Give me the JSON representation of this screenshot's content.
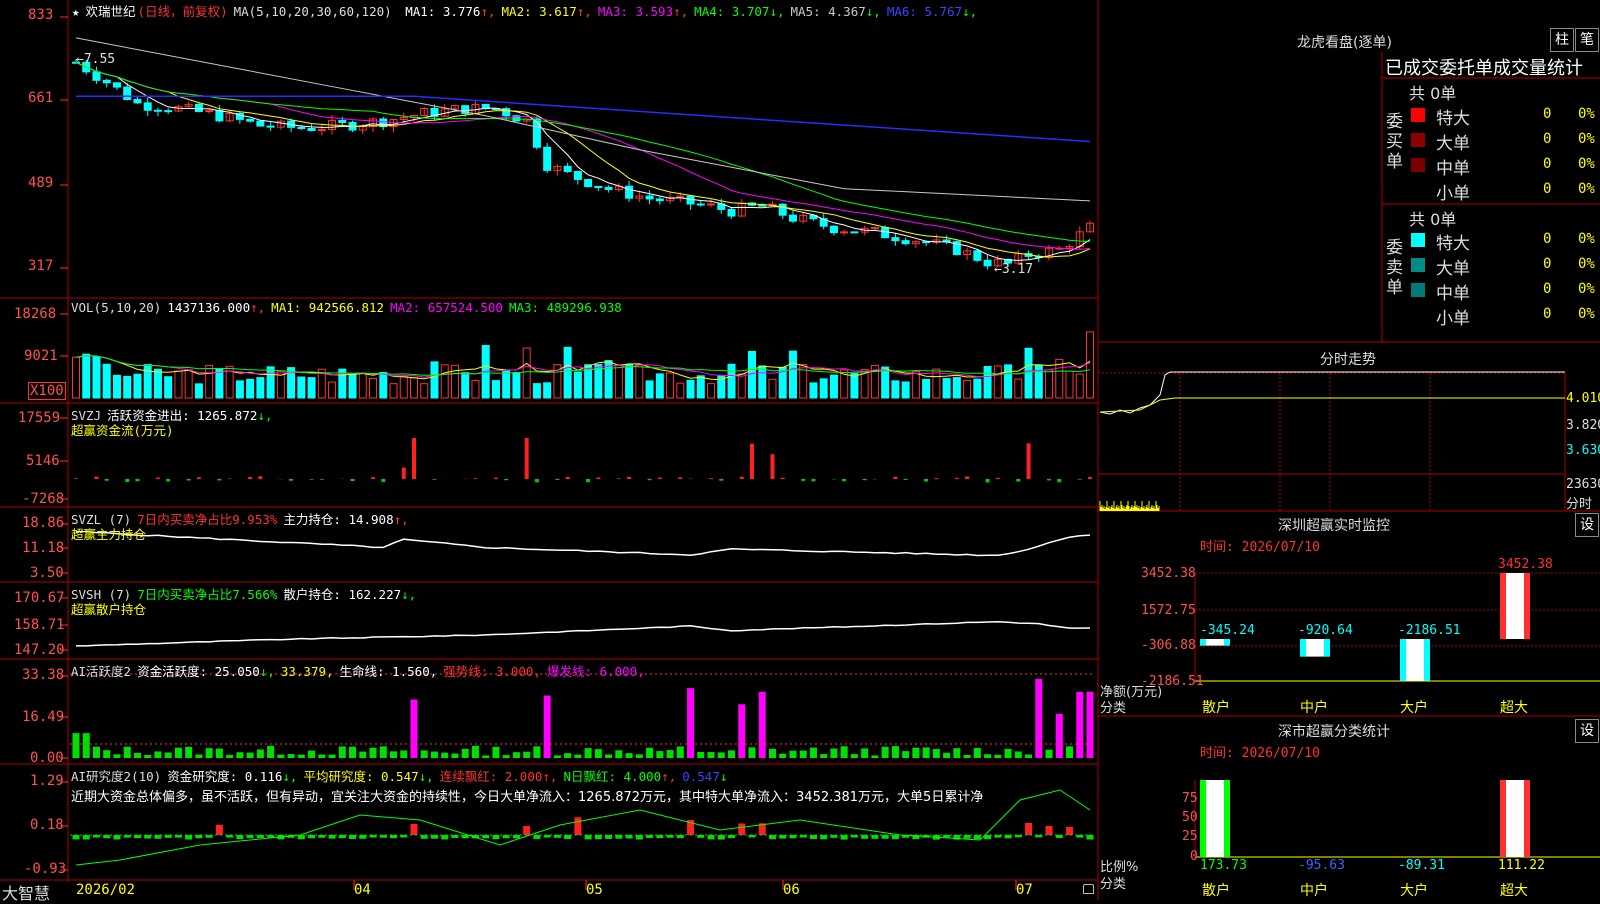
{
  "stock": {
    "name": "欢瑞世纪",
    "mode": "(日线，前复权)",
    "ma_header": "MA(5,10,20,30,60,120)",
    "mas": [
      {
        "label": "MA1:",
        "value": "3.776",
        "arrow": "↑",
        "color": "#ffffff"
      },
      {
        "label": "MA2:",
        "value": "3.617",
        "arrow": "↑",
        "color": "#ffff00"
      },
      {
        "label": "MA3:",
        "value": "3.593",
        "arrow": "↑",
        "color": "#ff00ff"
      },
      {
        "label": "MA4:",
        "value": "3.707",
        "arrow": "↓",
        "color": "#00ff00"
      },
      {
        "label": "MA5:",
        "value": "4.367",
        "arrow": "↓",
        "color": "#c8c8c8"
      },
      {
        "label": "MA6:",
        "value": "5.767",
        "arrow": "↓",
        "color": "#4040ff"
      }
    ],
    "price_axis": [
      "833",
      "661",
      "489",
      "317"
    ],
    "high_mark": "7.55",
    "low_mark": "3.17"
  },
  "vol": {
    "title": "VOL(5,10,20)",
    "value": "1437136.000",
    "ma1": "MA1: 942566.812",
    "ma2": "MA2: 657524.500",
    "ma3": "MA3: 489296.938",
    "axis": [
      "18268",
      "9021",
      "X100"
    ]
  },
  "svzj": {
    "title": "SVZJ",
    "label": "活跃资金进出: 1265.872",
    "arrow": "↓,",
    "sub": "超赢资金流(万元)",
    "axis": [
      "17559",
      "5146",
      "-7268"
    ]
  },
  "svzl": {
    "title": "SVZL (7)",
    "ratio": "7日内买卖净占比9.953%",
    "hold": "主力持仓: 14.908",
    "arrow": "↑,",
    "sub": "超赢主力持仓",
    "axis": [
      "18.86",
      "11.18",
      "3.50"
    ]
  },
  "svsh": {
    "title": "SVSH (7)",
    "ratio": "7日内买卖净占比7.566%",
    "hold": "散户持仓: 162.227",
    "arrow": "↓,",
    "sub": "超赢散户持仓",
    "axis": [
      "170.67",
      "158.71",
      "147.20"
    ]
  },
  "ai1": {
    "title": "AI活跃度2",
    "act": "资金活跃度: 25.050",
    "arrow": "↓,",
    "v2": "33.379,",
    "life": "生命线: 1.560,",
    "strong": "强势线: 3.000,",
    "burst": "爆发线: 6.000,",
    "axis": [
      "33.38",
      "16.49",
      "0.00"
    ]
  },
  "ai2": {
    "title": "AI研究度2(10)",
    "res": "资金研究度: 0.116",
    "arrow1": "↓,",
    "avg": "平均研究度: 0.547",
    "arrow2": "↓,",
    "cont": "连续飘红: 2.000",
    "arrow3": "↑,",
    "nday": "N日飘红: 4.000",
    "arrow4": "↑,",
    "last": "0.547",
    "arrow5": "↓",
    "comment": "近期大资金总体偏多，虽不活跃，但有异动，宜关注大资金的持续性，今日大单净流入：1265.872万元，其中特大单净流入：3452.381万元，大单5日累计净",
    "axis": [
      "1.29",
      "0.18",
      "-0.93"
    ]
  },
  "xaxis": {
    "brand": "大智慧",
    "labels": [
      "2026/02",
      "04",
      "05",
      "06",
      "07"
    ]
  },
  "right": {
    "title": "龙虎看盘(逐单)",
    "btn1": "柱",
    "btn2": "笔",
    "stat_title": "已成交委托单成交量统计",
    "buy_label": "委买单",
    "sell_label": "委卖单",
    "buy_total": "共 0单",
    "sell_total": "共 0单",
    "buy_rows": [
      {
        "name": "特大",
        "count": "0",
        "pct": "0%",
        "color": "#ff0000"
      },
      {
        "name": "大单",
        "count": "0",
        "pct": "0%",
        "color": "#8b0000"
      },
      {
        "name": "中单",
        "count": "0",
        "pct": "0%",
        "color": "#7a0000"
      },
      {
        "name": "小单",
        "count": "0",
        "pct": "0%",
        "color": ""
      }
    ],
    "sell_rows": [
      {
        "name": "特大",
        "count": "0",
        "pct": "0%",
        "color": "#00ffff"
      },
      {
        "name": "大单",
        "count": "0",
        "pct": "0%",
        "color": "#008b8b"
      },
      {
        "name": "中单",
        "count": "0",
        "pct": "0%",
        "color": "#007a7a"
      },
      {
        "name": "小单",
        "count": "0",
        "pct": "0%",
        "color": ""
      }
    ],
    "intraday_title": "分时走势",
    "intraday_axis": [
      "4.010",
      "3.820",
      "3.630",
      "23630",
      "分时"
    ],
    "monitor_title": "深圳超赢实时监控",
    "set_btn": "设",
    "time_label": "时间: 2026/07/10",
    "net_label": "净额(万元)",
    "cat_label": "分类",
    "monitor_axis": [
      "3452.38",
      "1572.75",
      "-306.88",
      "-2186.51"
    ],
    "classify_title": "深市超赢分类统计",
    "ratio_label": "比例%",
    "classify_axis": [
      "75",
      "50",
      "25",
      "0"
    ],
    "categories": [
      "散户",
      "中户",
      "大户",
      "超大"
    ],
    "monitor_values": [
      {
        "label": "-345.24",
        "value": -345.24
      },
      {
        "label": "-920.64",
        "value": -920.64
      },
      {
        "label": "-2186.51",
        "value": -2186.51
      },
      {
        "label": "3452.38",
        "value": 3452.38
      }
    ],
    "classify_values": [
      {
        "label": "173.73",
        "color": "#00ff00"
      },
      {
        "label": "-95.63",
        "color": "#4060ff"
      },
      {
        "label": "-89.31",
        "color": "#00ffff"
      },
      {
        "label": "111.22",
        "color": "#ffff00"
      }
    ]
  },
  "colors": {
    "up": "#ff3232",
    "down": "#00ffff",
    "grid": "#b00000",
    "green": "#00e000",
    "magenta": "#ff00ff",
    "axis_text": "#ff5050"
  }
}
